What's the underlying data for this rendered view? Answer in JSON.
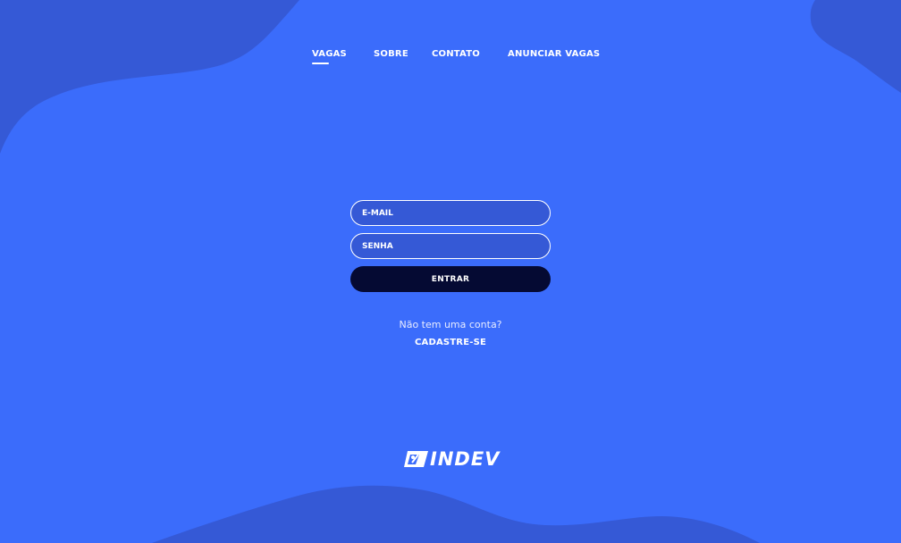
{
  "colors": {
    "background": "#3b6cfb",
    "wave": "#3559d6",
    "button": "#050a33",
    "text": "#ffffff"
  },
  "nav": {
    "items": [
      {
        "label": "VAGAS",
        "active": true
      },
      {
        "label": "SOBRE"
      },
      {
        "label": "CONTATO"
      },
      {
        "label": "ANUNCIAR VAGAS"
      }
    ]
  },
  "login": {
    "email_placeholder": "E-MAIL",
    "password_placeholder": "SENHA",
    "submit_label": "ENTRAR"
  },
  "signup": {
    "prompt": "Não tem uma conta?",
    "link_label": "CADASTRE-SE"
  },
  "footer": {
    "logo_text": "INDEV"
  }
}
